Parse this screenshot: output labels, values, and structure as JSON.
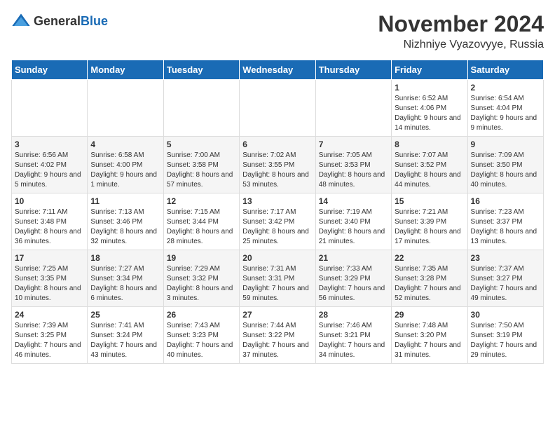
{
  "header": {
    "logo": {
      "text_general": "General",
      "text_blue": "Blue"
    },
    "title": "November 2024",
    "location": "Nizhniye Vyazovyye, Russia"
  },
  "days_of_week": [
    "Sunday",
    "Monday",
    "Tuesday",
    "Wednesday",
    "Thursday",
    "Friday",
    "Saturday"
  ],
  "weeks": [
    [
      {
        "day": "",
        "info": ""
      },
      {
        "day": "",
        "info": ""
      },
      {
        "day": "",
        "info": ""
      },
      {
        "day": "",
        "info": ""
      },
      {
        "day": "",
        "info": ""
      },
      {
        "day": "1",
        "info": "Sunrise: 6:52 AM\nSunset: 4:06 PM\nDaylight: 9 hours and 14 minutes."
      },
      {
        "day": "2",
        "info": "Sunrise: 6:54 AM\nSunset: 4:04 PM\nDaylight: 9 hours and 9 minutes."
      }
    ],
    [
      {
        "day": "3",
        "info": "Sunrise: 6:56 AM\nSunset: 4:02 PM\nDaylight: 9 hours and 5 minutes."
      },
      {
        "day": "4",
        "info": "Sunrise: 6:58 AM\nSunset: 4:00 PM\nDaylight: 9 hours and 1 minute."
      },
      {
        "day": "5",
        "info": "Sunrise: 7:00 AM\nSunset: 3:58 PM\nDaylight: 8 hours and 57 minutes."
      },
      {
        "day": "6",
        "info": "Sunrise: 7:02 AM\nSunset: 3:55 PM\nDaylight: 8 hours and 53 minutes."
      },
      {
        "day": "7",
        "info": "Sunrise: 7:05 AM\nSunset: 3:53 PM\nDaylight: 8 hours and 48 minutes."
      },
      {
        "day": "8",
        "info": "Sunrise: 7:07 AM\nSunset: 3:52 PM\nDaylight: 8 hours and 44 minutes."
      },
      {
        "day": "9",
        "info": "Sunrise: 7:09 AM\nSunset: 3:50 PM\nDaylight: 8 hours and 40 minutes."
      }
    ],
    [
      {
        "day": "10",
        "info": "Sunrise: 7:11 AM\nSunset: 3:48 PM\nDaylight: 8 hours and 36 minutes."
      },
      {
        "day": "11",
        "info": "Sunrise: 7:13 AM\nSunset: 3:46 PM\nDaylight: 8 hours and 32 minutes."
      },
      {
        "day": "12",
        "info": "Sunrise: 7:15 AM\nSunset: 3:44 PM\nDaylight: 8 hours and 28 minutes."
      },
      {
        "day": "13",
        "info": "Sunrise: 7:17 AM\nSunset: 3:42 PM\nDaylight: 8 hours and 25 minutes."
      },
      {
        "day": "14",
        "info": "Sunrise: 7:19 AM\nSunset: 3:40 PM\nDaylight: 8 hours and 21 minutes."
      },
      {
        "day": "15",
        "info": "Sunrise: 7:21 AM\nSunset: 3:39 PM\nDaylight: 8 hours and 17 minutes."
      },
      {
        "day": "16",
        "info": "Sunrise: 7:23 AM\nSunset: 3:37 PM\nDaylight: 8 hours and 13 minutes."
      }
    ],
    [
      {
        "day": "17",
        "info": "Sunrise: 7:25 AM\nSunset: 3:35 PM\nDaylight: 8 hours and 10 minutes."
      },
      {
        "day": "18",
        "info": "Sunrise: 7:27 AM\nSunset: 3:34 PM\nDaylight: 8 hours and 6 minutes."
      },
      {
        "day": "19",
        "info": "Sunrise: 7:29 AM\nSunset: 3:32 PM\nDaylight: 8 hours and 3 minutes."
      },
      {
        "day": "20",
        "info": "Sunrise: 7:31 AM\nSunset: 3:31 PM\nDaylight: 7 hours and 59 minutes."
      },
      {
        "day": "21",
        "info": "Sunrise: 7:33 AM\nSunset: 3:29 PM\nDaylight: 7 hours and 56 minutes."
      },
      {
        "day": "22",
        "info": "Sunrise: 7:35 AM\nSunset: 3:28 PM\nDaylight: 7 hours and 52 minutes."
      },
      {
        "day": "23",
        "info": "Sunrise: 7:37 AM\nSunset: 3:27 PM\nDaylight: 7 hours and 49 minutes."
      }
    ],
    [
      {
        "day": "24",
        "info": "Sunrise: 7:39 AM\nSunset: 3:25 PM\nDaylight: 7 hours and 46 minutes."
      },
      {
        "day": "25",
        "info": "Sunrise: 7:41 AM\nSunset: 3:24 PM\nDaylight: 7 hours and 43 minutes."
      },
      {
        "day": "26",
        "info": "Sunrise: 7:43 AM\nSunset: 3:23 PM\nDaylight: 7 hours and 40 minutes."
      },
      {
        "day": "27",
        "info": "Sunrise: 7:44 AM\nSunset: 3:22 PM\nDaylight: 7 hours and 37 minutes."
      },
      {
        "day": "28",
        "info": "Sunrise: 7:46 AM\nSunset: 3:21 PM\nDaylight: 7 hours and 34 minutes."
      },
      {
        "day": "29",
        "info": "Sunrise: 7:48 AM\nSunset: 3:20 PM\nDaylight: 7 hours and 31 minutes."
      },
      {
        "day": "30",
        "info": "Sunrise: 7:50 AM\nSunset: 3:19 PM\nDaylight: 7 hours and 29 minutes."
      }
    ]
  ]
}
